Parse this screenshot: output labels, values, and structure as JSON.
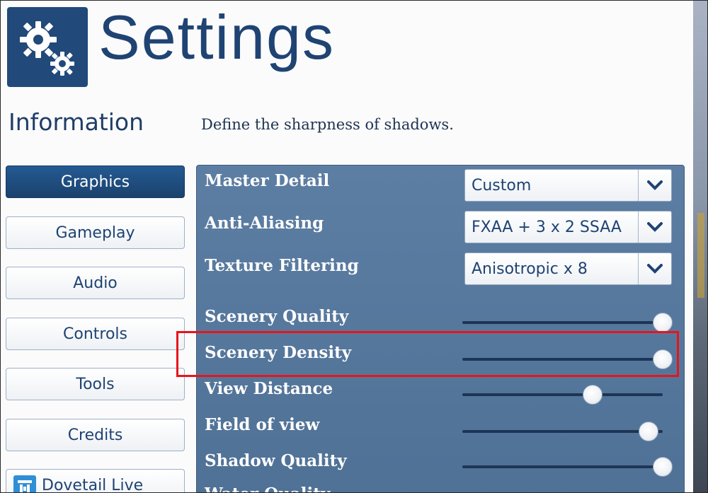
{
  "header": {
    "title": "Settings",
    "logo_icon": "gears-icon"
  },
  "info": {
    "heading": "Information",
    "description": "Define the sharpness of shadows."
  },
  "nav": {
    "items": [
      {
        "label": "Graphics",
        "active": true
      },
      {
        "label": "Gameplay",
        "active": false
      },
      {
        "label": "Audio",
        "active": false
      },
      {
        "label": "Controls",
        "active": false
      },
      {
        "label": "Tools",
        "active": false
      },
      {
        "label": "Credits",
        "active": false
      },
      {
        "label": "Dovetail Live",
        "active": false,
        "icon": "dovetail-live-icon"
      }
    ]
  },
  "settings": {
    "master_detail": {
      "label": "Master Detail",
      "value": "Custom"
    },
    "anti_aliasing": {
      "label": "Anti-Aliasing",
      "value": "FXAA + 3 x 2 SSAA"
    },
    "texture_filtering": {
      "label": "Texture Filtering",
      "value": "Anisotropic x 8"
    },
    "scenery_quality": {
      "label": "Scenery Quality",
      "level": 1.0
    },
    "scenery_density": {
      "label": "Scenery Density",
      "level": 1.0
    },
    "view_distance": {
      "label": "View Distance",
      "level": 0.65
    },
    "field_of_view": {
      "label": "Field of view",
      "level": 0.93
    },
    "shadow_quality": {
      "label": "Shadow Quality",
      "level": 1.0
    },
    "water_quality": {
      "label": "Water Quality"
    }
  },
  "colors": {
    "brand": "#1f4373",
    "panel": "#5d7ea3",
    "active_nav": "#1b426d",
    "highlight": "#e8141b"
  }
}
